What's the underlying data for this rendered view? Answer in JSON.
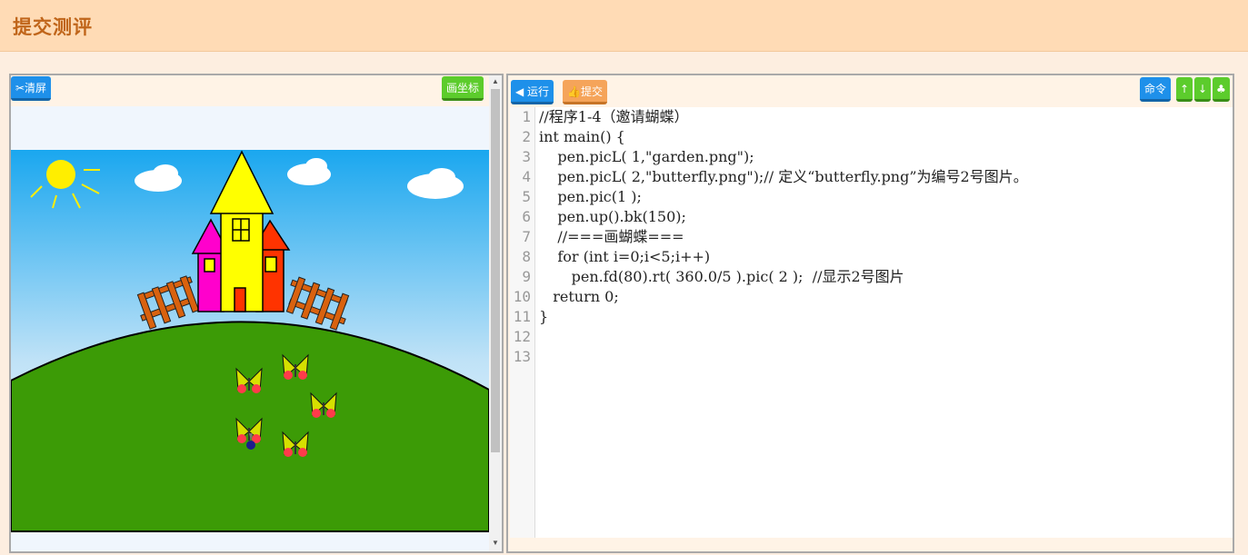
{
  "page_title": "提交测评",
  "left_toolbar": {
    "clear_label": "✂清屏",
    "grid_label": "画坐标"
  },
  "right_toolbar": {
    "run_label": "◀ 运行",
    "submit_label": "👍提交",
    "cmd_label": "命令",
    "up_label": "↑",
    "down_label": "↓",
    "club_label": "♣"
  },
  "code_lines": [
    "//程序1-4（邀请蝴蝶）",
    "int main() {",
    "    pen.picL( 1,\"garden.png\");",
    "    pen.picL( 2,\"butterfly.png\");// 定义“butterfly.png”为编号2号图片。",
    "    pen.pic(1 );",
    "    pen.up().bk(150);",
    "    //===画蝴蝶===",
    "    for (int i=0;i<5;i++)",
    "       pen.fd(80).rt( 360.0/5 ).pic( 2 );  //显示2号图片",
    "   return 0;",
    "}",
    "",
    ""
  ],
  "line_numbers": [
    "1",
    "2",
    "3",
    "4",
    "5",
    "6",
    "7",
    "8",
    "9",
    "10",
    "11",
    "12",
    "13"
  ],
  "colors": {
    "header_bg": "#ffdbb5",
    "title": "#c0651a",
    "run": "#1e90ea",
    "submit": "#f5a45a",
    "grid": "#5ccc2c"
  }
}
